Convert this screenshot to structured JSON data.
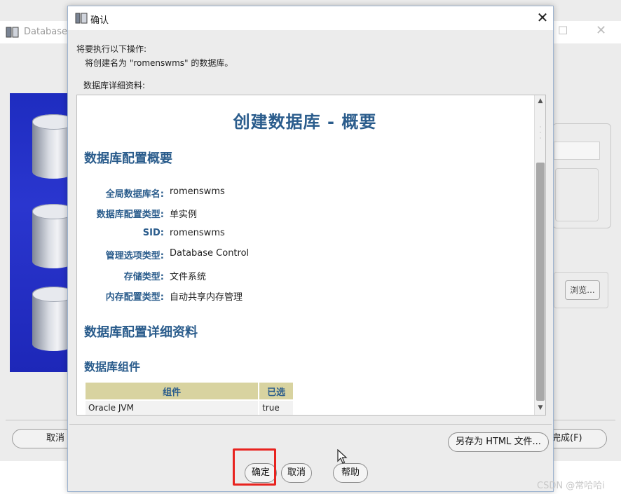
{
  "background_window": {
    "title": "Database",
    "browse_label": "浏览...",
    "cancel_label": "取消",
    "finish_label": "完成(F)"
  },
  "dialog": {
    "title": "确认",
    "close_glyph": "✕",
    "message_line1": "将要执行以下操作:",
    "message_line2": "将创建名为 \"romenswms\" 的数据库。",
    "details_label": "数据库详细资料:",
    "summary": {
      "title": "创建数据库 - 概要",
      "overview_heading": "数据库配置概要",
      "fields": [
        {
          "label": "全局数据库名:",
          "value": "romenswms"
        },
        {
          "label": "数据库配置类型:",
          "value": "单实例"
        },
        {
          "label": "SID:",
          "value": "romenswms"
        },
        {
          "label": "管理选项类型:",
          "value": "Database Control"
        },
        {
          "label": "存储类型:",
          "value": "文件系统"
        },
        {
          "label": "内存配置类型:",
          "value": "自动共享内存管理"
        }
      ],
      "details_heading": "数据库配置详细资料",
      "components_heading": "数据库组件",
      "components_table": {
        "headers": [
          "组件",
          "已选"
        ],
        "rows": [
          [
            "Oracle JVM",
            "true"
          ]
        ]
      }
    },
    "buttons": {
      "save_html": "另存为 HTML 文件...",
      "ok": "确定",
      "cancel": "取消",
      "help": "帮助"
    }
  },
  "watermark": "CSDN @常哈哈i",
  "colors": {
    "heading_blue": "#2a5c8c",
    "table_header": "#d8d3a0",
    "highlight_red": "#e8231f"
  }
}
